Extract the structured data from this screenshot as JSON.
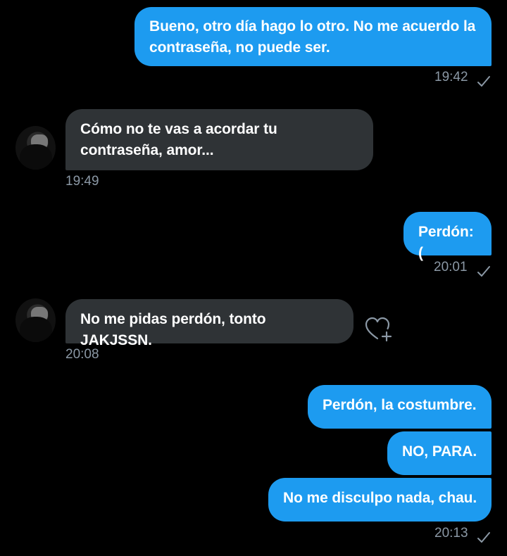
{
  "messages": [
    {
      "id": "m1",
      "dir": "out",
      "text": "Bueno, otro día hago lo otro. No me acuerdo la contraseña, no puede ser.",
      "time": "19:42"
    },
    {
      "id": "m2",
      "dir": "in",
      "text": "Cómo no te vas a acordar tu contraseña, amor...",
      "time": "19:49"
    },
    {
      "id": "m3",
      "dir": "out",
      "text": "Perdón:(",
      "time": "20:01"
    },
    {
      "id": "m4",
      "dir": "in",
      "text": "No me pidas perdón, tonto JAKJSSN.",
      "time": "20:08"
    },
    {
      "id": "m5",
      "dir": "out",
      "text": "Perdón, la costumbre."
    },
    {
      "id": "m6",
      "dir": "out",
      "text": "NO, PARA."
    },
    {
      "id": "m7",
      "dir": "out",
      "text": "No me disculpo nada, chau.",
      "time": "20:13"
    }
  ],
  "icons": {
    "read_receipt": "checkmark-icon",
    "react": "heart-add-icon",
    "avatar": "contact-avatar"
  },
  "colors": {
    "outgoing_bubble": "#1d9bf0",
    "incoming_bubble": "#2f3336",
    "timestamp": "#8b98a5",
    "background": "#000000"
  }
}
